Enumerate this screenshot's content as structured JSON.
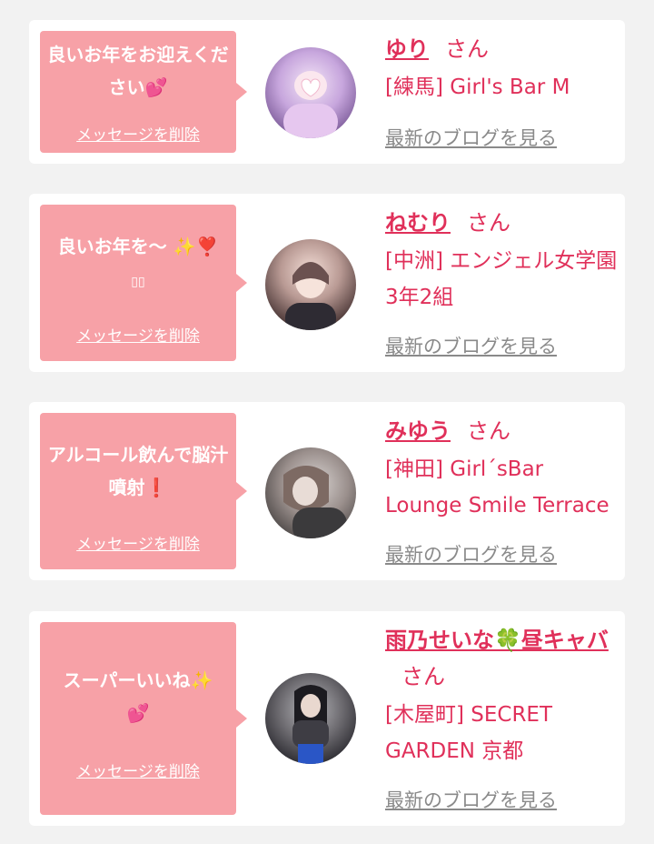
{
  "delete_label": "メッセージを削除",
  "blog_label": "最新のブログを見る",
  "san_label": "さん",
  "cards": [
    {
      "message": "良いお年をお迎えください",
      "message_emoji": "💕",
      "name": "ゆり",
      "shop": "[練馬] Girl's Bar M"
    },
    {
      "message": "良いお年を〜",
      "message_emoji": "✨❣️",
      "message_extra": "▯▯",
      "name": "ねむり",
      "shop": "[中洲] エンジェル女学園 3年2組"
    },
    {
      "message": "アルコール飲んで脳汁噴射",
      "message_emoji": "❗",
      "name": "みゆう",
      "shop": "[神田] Girl´sBar Lounge Smile Terrace"
    },
    {
      "message": "スーパーいいね",
      "message_emoji": "✨",
      "message_emoji2": "💕",
      "name": "雨乃せいな🍀昼キャバ",
      "shop": "[木屋町] SECRET GARDEN 京都"
    }
  ],
  "colors": {
    "background": "#f2f2f2",
    "bubble": "#f7a1a7",
    "accent": "#e0305a",
    "link_gray": "#8a8a8a"
  }
}
